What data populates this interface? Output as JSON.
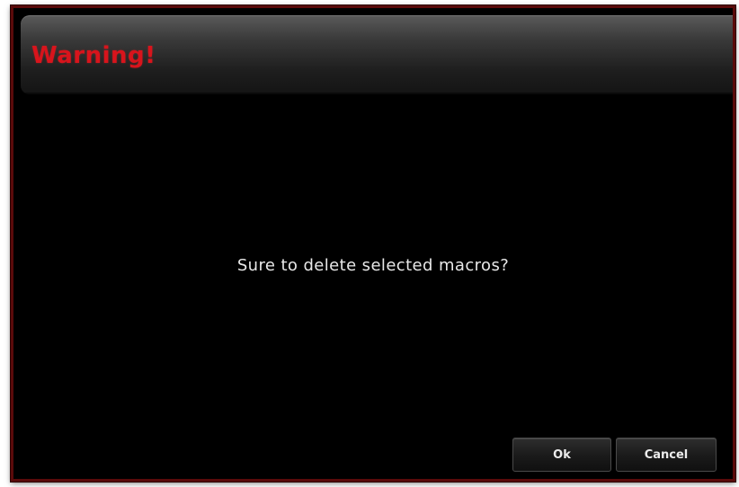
{
  "dialog": {
    "title": "Warning!",
    "message": "Sure to delete selected macros?",
    "buttons": {
      "ok_label": "Ok",
      "cancel_label": "Cancel"
    }
  },
  "colors": {
    "title": "#d8141c",
    "border": "#5a0a0a",
    "background": "#000000"
  }
}
